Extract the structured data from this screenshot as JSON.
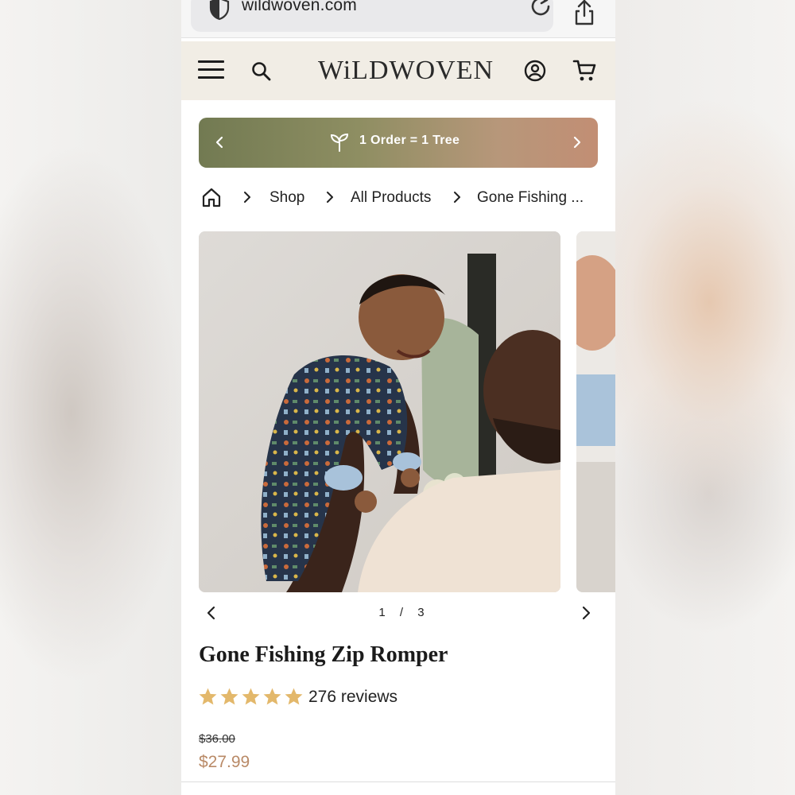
{
  "browser": {
    "url": "wildwoven.com"
  },
  "header": {
    "logo_text": "WiLDWOVEN"
  },
  "promo": {
    "text": "1 Order = 1 Tree"
  },
  "breadcrumb": {
    "items": [
      "Shop",
      "All Products",
      "Gone Fishing ..."
    ]
  },
  "gallery": {
    "current": "1",
    "separator": "/",
    "total": "3"
  },
  "product": {
    "title": "Gone Fishing Zip Romper",
    "rating": 5,
    "reviews": "276 reviews",
    "price_original": "$36.00",
    "price_sale": "$27.99"
  },
  "colors": {
    "price_sale": "#b98a67",
    "star": "#e3b86b",
    "header_bg": "#f1ede5",
    "promo_start": "#727a52",
    "promo_end": "#c28e74"
  }
}
